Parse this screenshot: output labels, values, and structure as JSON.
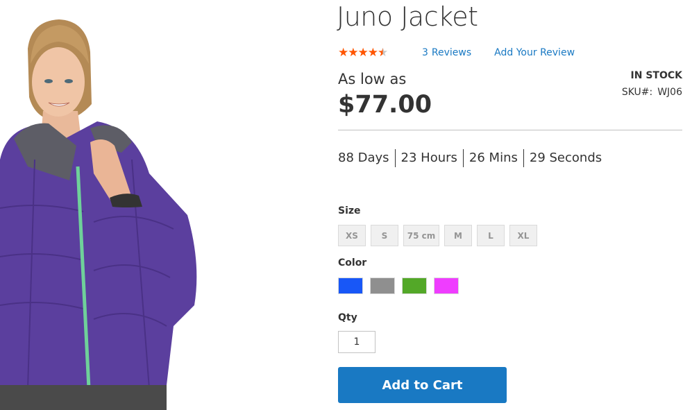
{
  "product": {
    "title": "Juno Jacket",
    "rating_fraction": 0.8,
    "reviews_count": "3",
    "reviews_label": "Reviews",
    "add_review_label": "Add Your Review",
    "price_prefix": "As low as",
    "price": "$77.00",
    "stock_status": "IN STOCK",
    "sku_label": "SKU#:",
    "sku_value": "WJ06",
    "colors": {
      "star_filled": "#ff5501",
      "star_empty": "#c7c7c7",
      "link": "#1979c3",
      "button": "#1979c3"
    }
  },
  "countdown": {
    "days": "88 Days",
    "hours": "23 Hours",
    "mins": "26 Mins",
    "seconds": "29 Seconds"
  },
  "options": {
    "size_label": "Size",
    "sizes": [
      "XS",
      "S",
      "75 cm",
      "M",
      "L",
      "XL"
    ],
    "color_label": "Color",
    "colors": [
      {
        "name": "Blue",
        "hex": "#1857f7"
      },
      {
        "name": "Gray",
        "hex": "#8f8f8f"
      },
      {
        "name": "Green",
        "hex": "#53a828"
      },
      {
        "name": "Purple",
        "hex": "#ef3dff"
      }
    ],
    "qty_label": "Qty",
    "qty_value": "1"
  },
  "actions": {
    "add_to_cart_label": "Add to Cart"
  },
  "image": {
    "subject": "woman wearing purple quilted jacket with green zipper",
    "jacket_color": "#5b3f9e",
    "zipper_color": "#6fd19a"
  }
}
